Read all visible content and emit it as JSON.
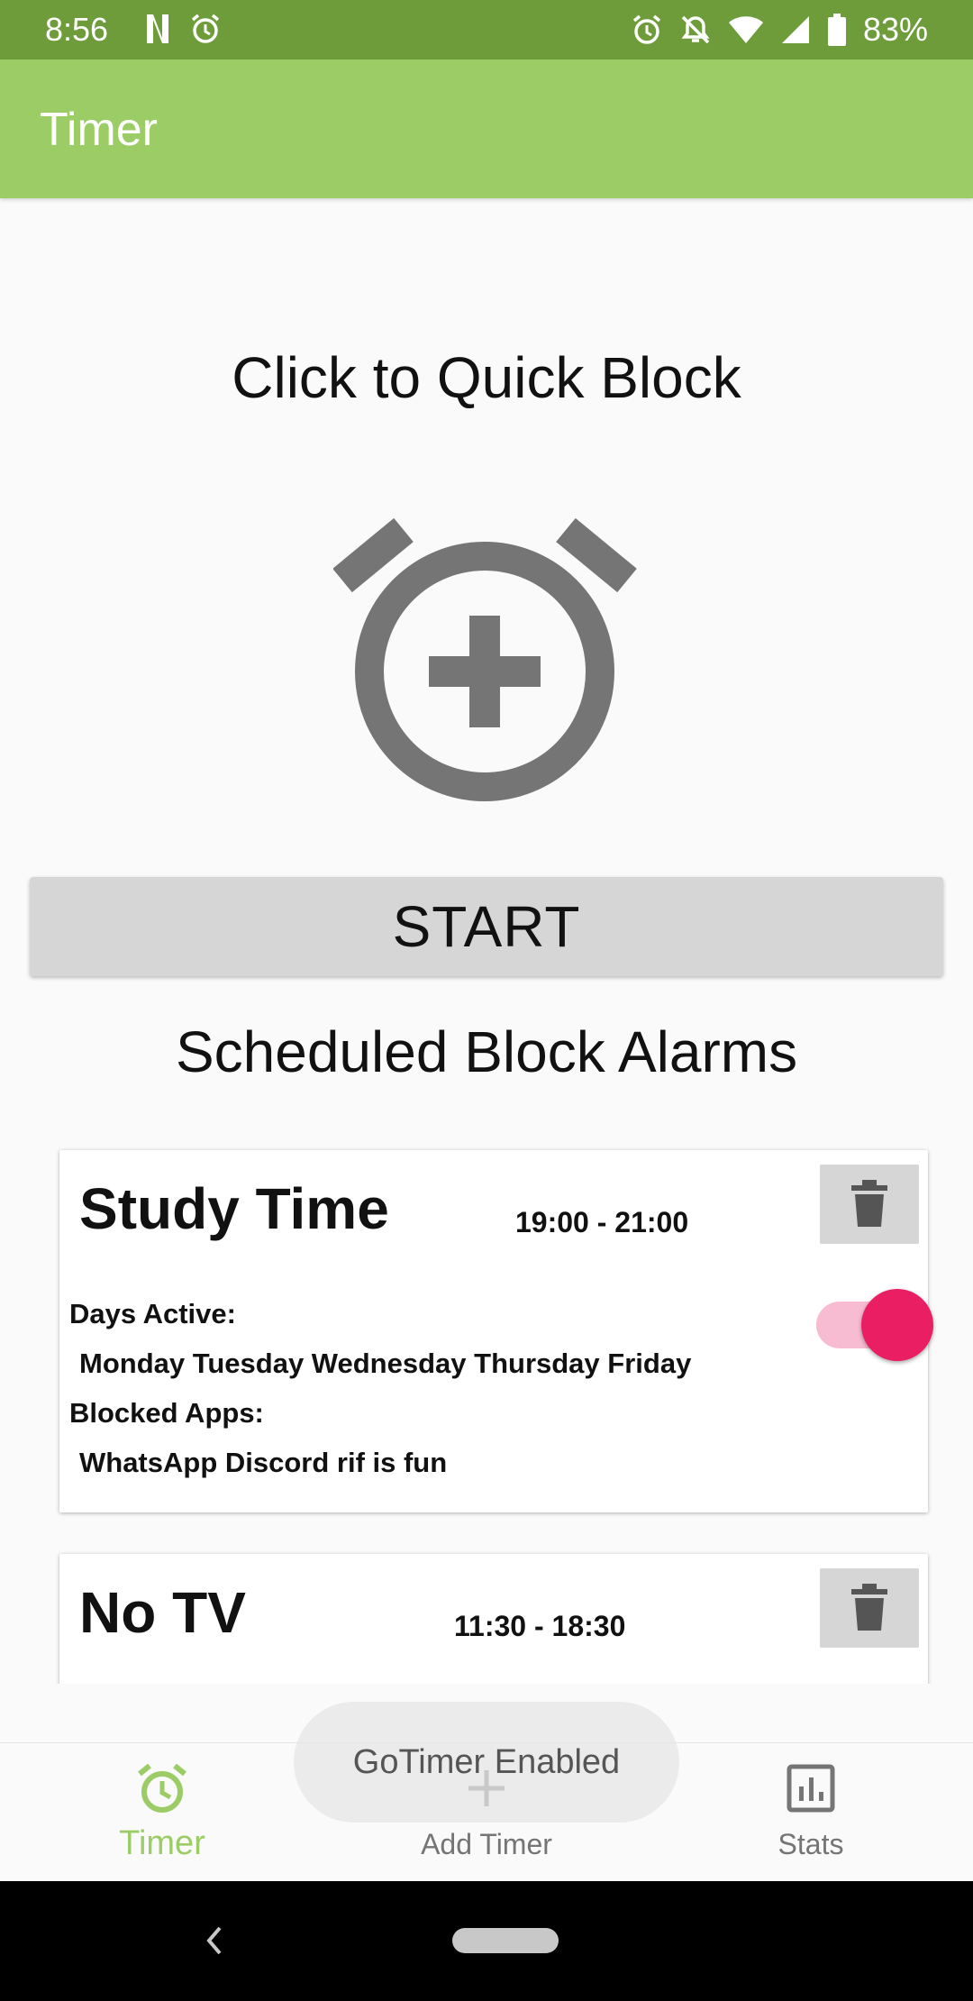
{
  "status_bar": {
    "time": "8:56",
    "battery": "83%",
    "left_icons": [
      "netflix-icon",
      "alarm-icon"
    ],
    "right_icons": [
      "alarm-icon",
      "notifications-off-icon",
      "wifi-icon",
      "signal-icon",
      "battery-icon"
    ]
  },
  "app_bar": {
    "title": "Timer"
  },
  "quick_block": {
    "title": "Click to Quick Block",
    "icon": "alarm-add-icon"
  },
  "start_button": {
    "label": "START"
  },
  "scheduled": {
    "title": "Scheduled Block Alarms"
  },
  "alarms": [
    {
      "name": "Study Time",
      "hours": "19:00 - 21:00",
      "days_label": "Days Active:",
      "days": "Monday Tuesday Wednesday Thursday Friday",
      "apps_label": "Blocked Apps:",
      "apps": "WhatsApp Discord rif is fun",
      "enabled": true
    },
    {
      "name": "No TV",
      "hours": "11:30 - 18:30"
    }
  ],
  "bottom_nav": {
    "items": [
      {
        "label": "Timer",
        "icon": "alarm-icon",
        "active": true
      },
      {
        "label": "Add Timer",
        "icon": "plus-icon",
        "active": false
      },
      {
        "label": "Stats",
        "icon": "bar-chart-icon",
        "active": false
      }
    ]
  },
  "toast": {
    "text": "GoTimer Enabled"
  },
  "colors": {
    "status_bar": "#6e9c3a",
    "app_bar": "#9ccc65",
    "accent": "#e91e63",
    "active_nav": "#9ccc65"
  }
}
